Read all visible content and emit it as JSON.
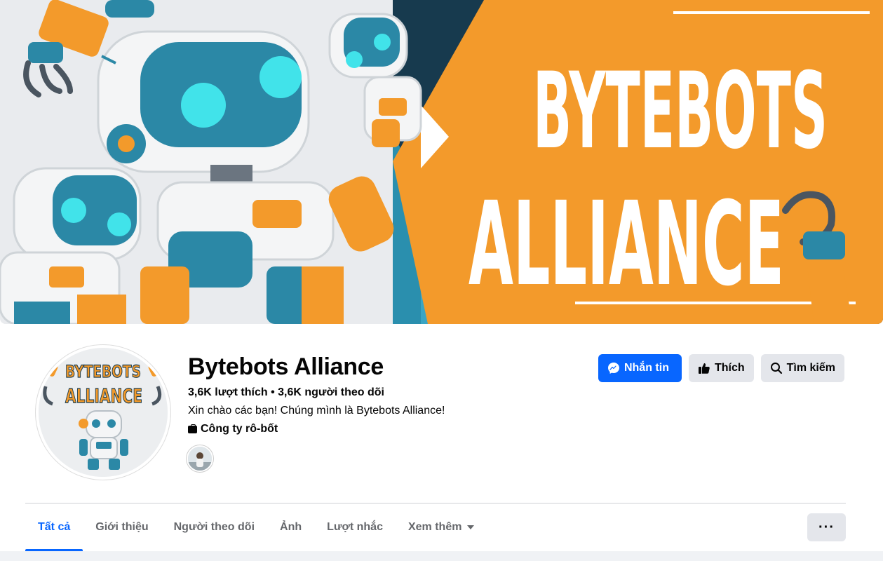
{
  "cover": {
    "title_line1": "BYTEBOTS",
    "title_line2": "ALLIANCE",
    "colors": {
      "orange": "#f39a2b",
      "teal": "#2a8fae",
      "navy": "#173a4e",
      "bg": "#e9ebee"
    }
  },
  "avatar": {
    "title_line1": "BYTEBOTS",
    "title_line2": "ALLIANCE"
  },
  "page": {
    "name": "Bytebots Alliance",
    "stats": "3,6K lượt thích • 3,6K người theo dõi",
    "bio": "Xin chào các bạn! Chúng mình là Bytebots Alliance!",
    "category": "Công ty rô-bốt"
  },
  "actions": {
    "message_label": "Nhắn tin",
    "like_label": "Thích",
    "search_label": "Tìm kiếm"
  },
  "tabs": [
    {
      "label": "Tất cả",
      "active": true
    },
    {
      "label": "Giới thiệu"
    },
    {
      "label": "Người theo dõi"
    },
    {
      "label": "Ảnh"
    },
    {
      "label": "Lượt nhắc"
    },
    {
      "label": "Xem thêm"
    }
  ],
  "more_menu": {
    "label": "···"
  },
  "colors": {
    "accent": "#0866ff",
    "button_gray": "#e4e6eb",
    "text_secondary": "#65676b"
  }
}
